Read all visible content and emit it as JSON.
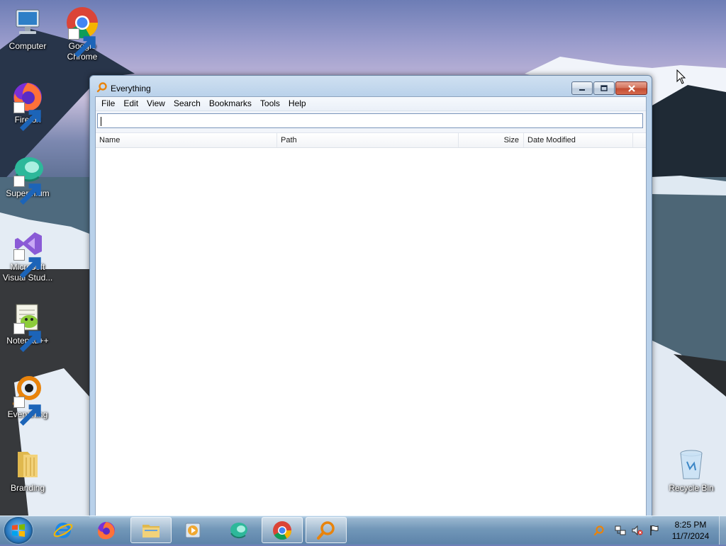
{
  "desktop": {
    "icons": [
      {
        "label": "Computer",
        "icon": "computer-icon"
      },
      {
        "label": "Google Chrome",
        "icon": "chrome-icon"
      },
      {
        "label": "Firefox",
        "icon": "firefox-icon"
      },
      {
        "label": "Supermium",
        "icon": "supermium-icon"
      },
      {
        "label": "Microsoft Visual Stud...",
        "icon": "visual-studio-icon"
      },
      {
        "label": "Notepad++",
        "icon": "notepadpp-icon"
      },
      {
        "label": "Everything",
        "icon": "everything-icon"
      },
      {
        "label": "Branding",
        "icon": "folder-icon"
      },
      {
        "label": "Recycle Bin",
        "icon": "recycle-bin-icon"
      }
    ]
  },
  "window": {
    "title": "Everything",
    "menu": [
      "File",
      "Edit",
      "View",
      "Search",
      "Bookmarks",
      "Tools",
      "Help"
    ],
    "search": {
      "value": "",
      "placeholder": ""
    },
    "columns": [
      "Name",
      "Path",
      "Size",
      "Date Modified"
    ],
    "results": []
  },
  "taskbar": {
    "pinned": [
      "internet-explorer-icon",
      "firefox-icon",
      "file-explorer-icon",
      "media-player-icon",
      "supermium-icon",
      "chrome-icon",
      "everything-icon"
    ],
    "active": "everything-icon"
  },
  "tray": {
    "time": "8:25 PM",
    "date": "11/7/2024",
    "icons": [
      "everything-tray-icon",
      "network-icon",
      "volume-muted-icon",
      "action-center-flag-icon"
    ]
  },
  "colors": {
    "accent": "#b9d1ea",
    "close_button": "#c24b32",
    "everything_orange": "#e8830c"
  }
}
